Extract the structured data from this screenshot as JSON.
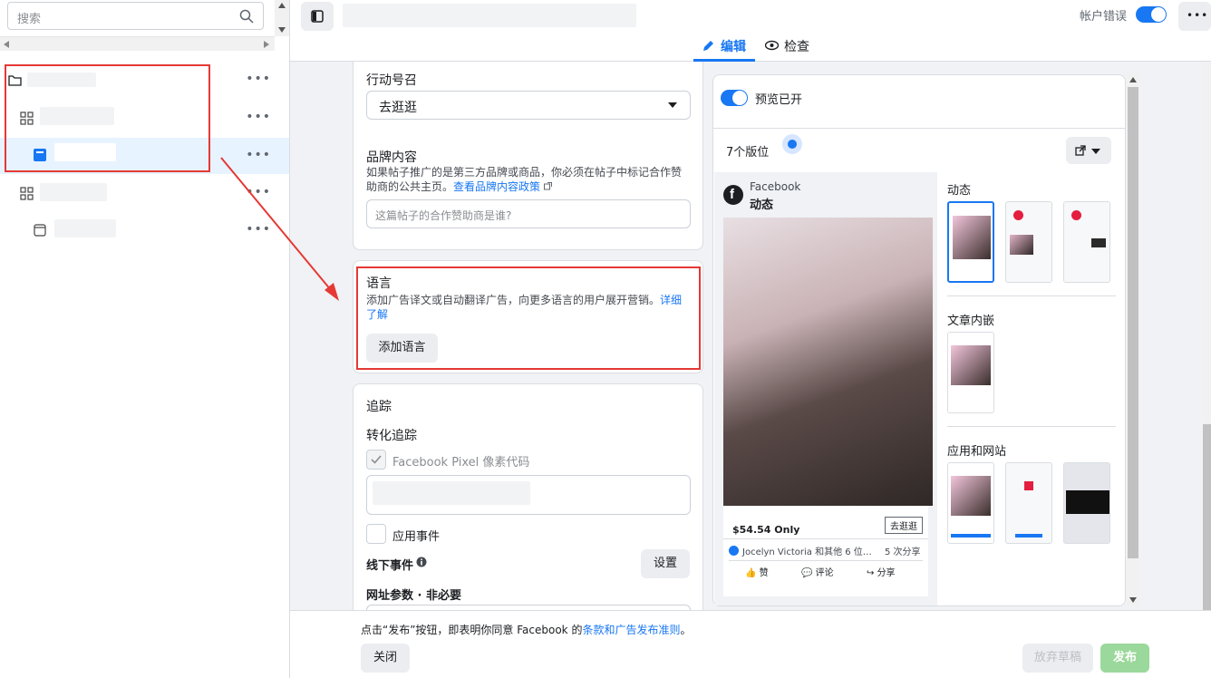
{
  "left_panel": {
    "search_placeholder": "搜索"
  },
  "topbar": {
    "tabs": [
      {
        "label": "编辑",
        "icon": "pencil-icon"
      },
      {
        "label": "检查",
        "icon": "eye-icon"
      }
    ],
    "account_error_label": "帐户错误",
    "account_error_toggle": true
  },
  "form": {
    "cta_label": "行动号召",
    "cta_value": "去逛逛",
    "brand_title": "品牌内容",
    "brand_desc": "如果帖子推广的是第三方品牌或商品，你必须在帖子中标记合作赞助商的公共主页。",
    "brand_link": "查看品牌内容政策",
    "brand_placeholder": "这篇帖子的合作赞助商是谁?",
    "language_title": "语言",
    "language_desc": "添加广告译文或自动翻译广告，向更多语言的用户展开营销。",
    "language_link": "详细了解",
    "add_language_button": "添加语言",
    "tracking_title": "追踪",
    "conversion_title": "转化追踪",
    "pixel_label": "Facebook Pixel 像素代码",
    "app_events_label": "应用事件",
    "offline_events_label": "线下事件",
    "offline_settings_button": "设置",
    "url_params_label": "网址参数 · 非必要"
  },
  "preview": {
    "preview_on_label": "预览已开",
    "placements_count": "7个版位",
    "post_page": "Facebook",
    "post_section": "动态",
    "price_text": "$54.54 Only",
    "cta_small": "去逛逛",
    "reactions_text": "Jocelyn Victoria 和其他 6 位…",
    "shares_text": "5 次分享",
    "actions": [
      "赞",
      "评论",
      "分享"
    ],
    "groups": [
      "动态",
      "文章内嵌",
      "应用和网站"
    ]
  },
  "bottom": {
    "terms_prefix": "点击“发布”按钮，即表明你同意 Facebook 的",
    "terms_link": "条款和广告发布准则",
    "terms_suffix": "。",
    "close_button": "关闭",
    "discard_button": "放弃草稿",
    "publish_button": "发布"
  },
  "colors": {
    "accent": "#1877f2",
    "annotation": "#e53935",
    "publish": "#9bd89b"
  }
}
